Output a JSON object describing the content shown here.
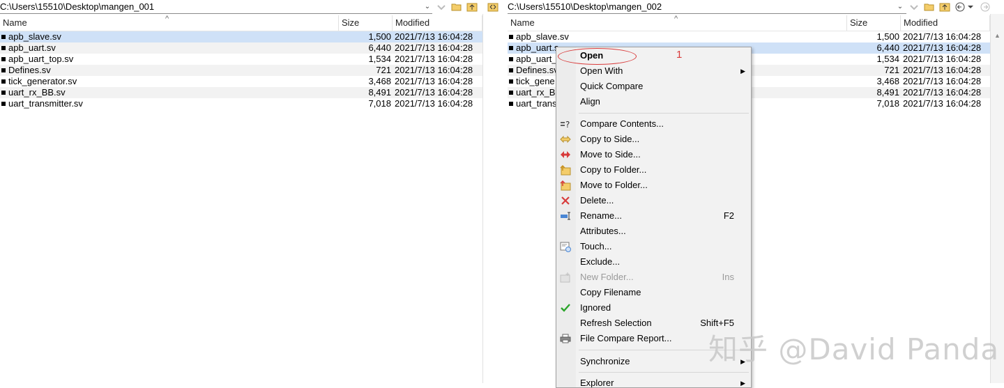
{
  "left": {
    "path": "C:\\Users\\15510\\Desktop\\mangen_001",
    "columns": {
      "name": "Name",
      "size": "Size",
      "modified": "Modified"
    },
    "files": [
      {
        "name": "apb_slave.sv",
        "size": "1,500",
        "modified": "2021/7/13 16:04:28"
      },
      {
        "name": "apb_uart.sv",
        "size": "6,440",
        "modified": "2021/7/13 16:04:28"
      },
      {
        "name": "apb_uart_top.sv",
        "size": "1,534",
        "modified": "2021/7/13 16:04:28"
      },
      {
        "name": "Defines.sv",
        "size": "721",
        "modified": "2021/7/13 16:04:28"
      },
      {
        "name": "tick_generator.sv",
        "size": "3,468",
        "modified": "2021/7/13 16:04:28"
      },
      {
        "name": "uart_rx_BB.sv",
        "size": "8,491",
        "modified": "2021/7/13 16:04:28"
      },
      {
        "name": "uart_transmitter.sv",
        "size": "7,018",
        "modified": "2021/7/13 16:04:28"
      }
    ]
  },
  "right": {
    "path": "C:\\Users\\15510\\Desktop\\mangen_002",
    "columns": {
      "name": "Name",
      "size": "Size",
      "modified": "Modified"
    },
    "files": [
      {
        "name": "apb_slave.sv",
        "size": "1,500",
        "modified": "2021/7/13 16:04:28"
      },
      {
        "name": "apb_uart.s",
        "size": "6,440",
        "modified": "2021/7/13 16:04:28"
      },
      {
        "name": "apb_uart_",
        "size": "1,534",
        "modified": "2021/7/13 16:04:28"
      },
      {
        "name": "Defines.sv",
        "size": "721",
        "modified": "2021/7/13 16:04:28"
      },
      {
        "name": "tick_gene",
        "size": "3,468",
        "modified": "2021/7/13 16:04:28"
      },
      {
        "name": "uart_rx_BE",
        "size": "8,491",
        "modified": "2021/7/13 16:04:28"
      },
      {
        "name": "uart_trans",
        "size": "7,018",
        "modified": "2021/7/13 16:04:28"
      }
    ]
  },
  "menu": {
    "open": "Open",
    "open_with": "Open With",
    "quick_compare": "Quick Compare",
    "align": "Align",
    "compare_contents": "Compare Contents...",
    "copy_to_side": "Copy to Side...",
    "move_to_side": "Move to Side...",
    "copy_to_folder": "Copy to Folder...",
    "move_to_folder": "Move to Folder...",
    "delete": "Delete...",
    "rename": "Rename...",
    "rename_shortcut": "F2",
    "attributes": "Attributes...",
    "touch": "Touch...",
    "exclude": "Exclude...",
    "new_folder": "New Folder...",
    "new_folder_shortcut": "Ins",
    "copy_filename": "Copy Filename",
    "ignored": "Ignored",
    "refresh_selection": "Refresh Selection",
    "refresh_shortcut": "Shift+F5",
    "file_compare_report": "File Compare Report...",
    "synchronize": "Synchronize",
    "explorer": "Explorer"
  },
  "annotation_number": "1",
  "watermark": "知乎 @David Panda",
  "colors": {
    "selection": "#cfe1f7",
    "annotation": "#d93a3a",
    "ignored_check": "#2aa52a",
    "delete_x": "#d83b3b"
  }
}
